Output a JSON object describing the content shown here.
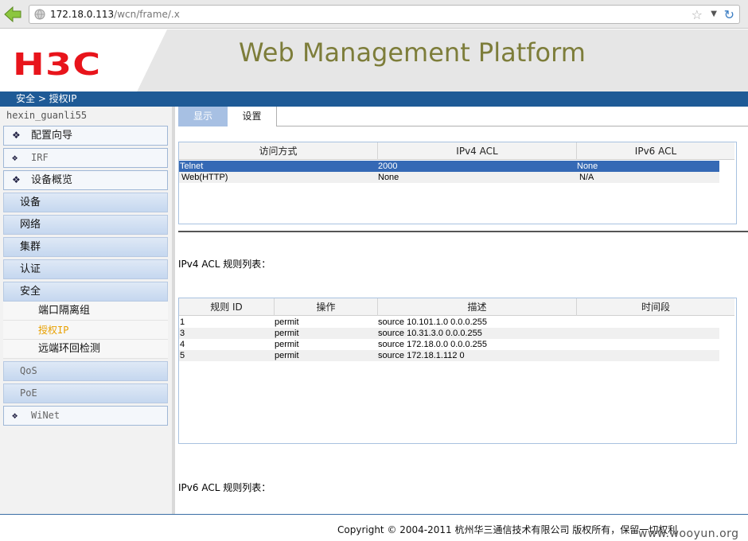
{
  "browser": {
    "url_host": "172.18.0.113",
    "url_path": "/wcn/frame/.x"
  },
  "header": {
    "logo_text": "H3C",
    "title": "Web Management Platform"
  },
  "breadcrumb": "安全 > 授权IP",
  "sidebar": {
    "username": "hexin_guanli55",
    "items": [
      {
        "label": "配置向导"
      },
      {
        "label": "IRF"
      },
      {
        "label": "设备概览"
      },
      {
        "label": "设备"
      },
      {
        "label": "网络"
      },
      {
        "label": "集群"
      },
      {
        "label": "认证"
      },
      {
        "label": "安全"
      },
      {
        "label": "端口隔离组"
      },
      {
        "label": "授权IP"
      },
      {
        "label": "远端环回检测"
      },
      {
        "label": "QoS"
      },
      {
        "label": "PoE"
      },
      {
        "label": "WiNet"
      }
    ]
  },
  "tabs": [
    {
      "label": "显示"
    },
    {
      "label": "设置"
    }
  ],
  "access_table": {
    "headers": [
      "访问方式",
      "IPv4 ACL",
      "IPv6 ACL"
    ],
    "rows": [
      [
        "Telnet",
        "2000",
        "None"
      ],
      [
        "Web(HTTP)",
        "None",
        "N/A"
      ]
    ],
    "selected_row": 0
  },
  "ipv4_label": "IPv4 ACL 规则列表：",
  "ipv4_table": {
    "headers": [
      "规则 ID",
      "操作",
      "描述",
      "时间段"
    ],
    "rows": [
      [
        "1",
        "permit",
        "source 10.101.1.0 0.0.0.255",
        ""
      ],
      [
        "3",
        "permit",
        "source 10.31.3.0 0.0.0.255",
        ""
      ],
      [
        "4",
        "permit",
        "source 172.18.0.0 0.0.0.255",
        ""
      ],
      [
        "5",
        "permit",
        "source 172.18.1.112 0",
        ""
      ]
    ]
  },
  "ipv6_label": "IPv6 ACL 规则列表：",
  "footer": {
    "copyright": "Copyright © 2004-2011 杭州华三通信技术有限公司 版权所有，保留一切权利",
    "watermark": "www.wooyun.org"
  },
  "colors": {
    "brand_red": "#e8141b",
    "nav_blue": "#1e5a96",
    "selected_row": "#3569b5",
    "active_submenu": "#e8a000"
  }
}
